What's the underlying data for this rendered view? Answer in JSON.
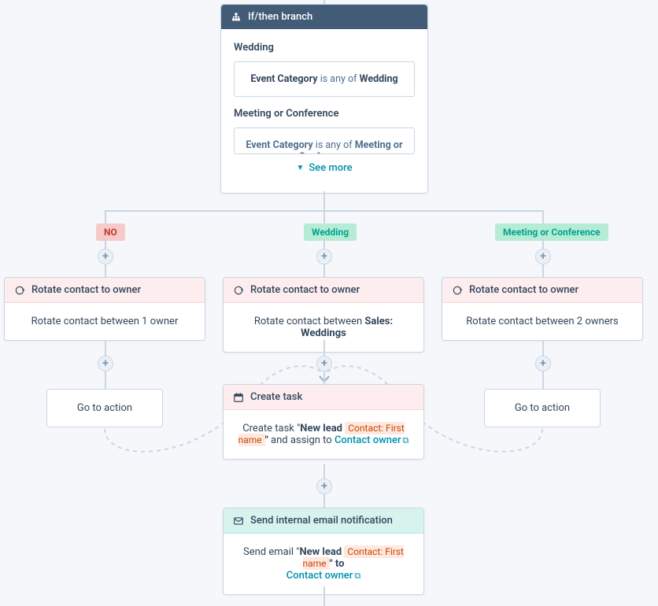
{
  "branch": {
    "title": "If/then branch",
    "group1": {
      "title": "Wedding",
      "filter_prop": "Event Category",
      "filter_op": "is any of",
      "filter_val": "Wedding"
    },
    "group2": {
      "title": "Meeting or Conference",
      "filter_prop": "Event Category",
      "filter_op": "is any of",
      "filter_val": "Meeting or Conference"
    },
    "see_more": "See more"
  },
  "labels": {
    "no": "NO",
    "wedding": "Wedding",
    "meeting": "Meeting or Conference"
  },
  "rotate": {
    "header": "Rotate contact to owner",
    "body1": "Rotate contact between 1 owner",
    "body2_pre": "Rotate contact between ",
    "body2_strong": "Sales: Weddings",
    "body3": "Rotate contact between 2 owners"
  },
  "goto": {
    "label": "Go to action"
  },
  "task": {
    "header": "Create task",
    "pre": "Create task \"",
    "lead": "New lead ",
    "token": "Contact: First name",
    "quote_end": "\"",
    "assign": " and assign to ",
    "owner": "Contact owner"
  },
  "email": {
    "header": "Send internal email notification",
    "pre": "Send email \"",
    "lead": "New lead ",
    "token": "Contact: First name",
    "quote_end": "\" to",
    "owner": "Contact owner"
  }
}
